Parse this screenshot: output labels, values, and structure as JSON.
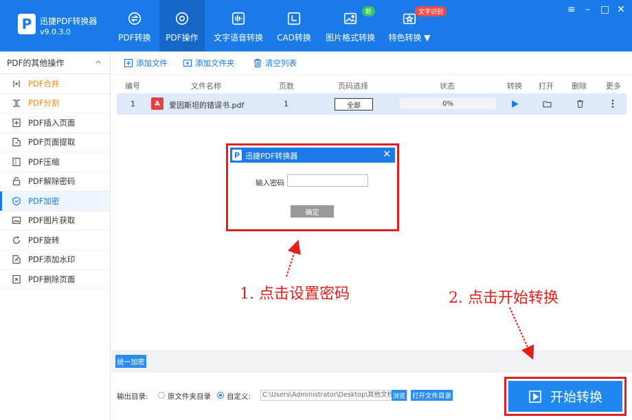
{
  "app": {
    "name": "迅捷PDF转换器",
    "version": "v9.0.3.0"
  },
  "tabs": [
    {
      "label": "PDF转换",
      "icon": "pdf-convert-icon"
    },
    {
      "label": "PDF操作",
      "icon": "gear-icon",
      "active": true
    },
    {
      "label": "文字语音转换",
      "icon": "audio-wave-icon"
    },
    {
      "label": "CAD转换",
      "icon": "cad-icon"
    },
    {
      "label": "图片格式转换",
      "icon": "image-icon"
    },
    {
      "label": "特色转换",
      "icon": "star-convert-icon"
    }
  ],
  "badges": {
    "new": "新",
    "feature": "文字识别"
  },
  "window_controls": {
    "menu": "≡",
    "minimize": "–",
    "maximize": "□",
    "close": "✕"
  },
  "sidebar": {
    "header": "PDF的其他操作",
    "items": [
      {
        "label": "PDF合并",
        "icon": "merge-icon",
        "style": "orange"
      },
      {
        "label": "PDF分割",
        "icon": "split-icon",
        "style": "orange"
      },
      {
        "label": "PDF插入页面",
        "icon": "insert-page-icon"
      },
      {
        "label": "PDF页面提取",
        "icon": "extract-page-icon"
      },
      {
        "label": "PDF压缩",
        "icon": "compress-icon"
      },
      {
        "label": "PDF解除密码",
        "icon": "unlock-icon"
      },
      {
        "label": "PDF加密",
        "icon": "shield-icon",
        "style": "blue",
        "active": true
      },
      {
        "label": "PDF图片获取",
        "icon": "picture-icon"
      },
      {
        "label": "PDF旋转",
        "icon": "rotate-icon"
      },
      {
        "label": "PDF添加水印",
        "icon": "watermark-icon"
      },
      {
        "label": "PDF删除页面",
        "icon": "delete-page-icon"
      }
    ]
  },
  "toolbar": {
    "add_file": "添加文件",
    "add_folder": "添加文件夹",
    "clear_list": "清空列表"
  },
  "table": {
    "headers": {
      "index": "编号",
      "filename": "文件名称",
      "pages": "页数",
      "page_select": "页码选择",
      "status": "状态",
      "convert": "转换",
      "open": "打开",
      "delete": "删除",
      "more": "更多"
    },
    "rows": [
      {
        "index": "1",
        "filename": "爱因斯坦的错误书.pdf",
        "pages": "1",
        "page_select": "全部",
        "status": "0%",
        "progress": 0
      }
    ]
  },
  "dialog": {
    "title": "迅捷PDF转换器",
    "password_label": "输入密码",
    "ok": "确定",
    "close": "✕"
  },
  "bottom": {
    "unify_button": "统一加密",
    "output_label": "输出目录:",
    "option_original": "原文件夹目录",
    "option_custom": "自定义:",
    "path": "C:\\Users\\Administrator\\Desktop\\其他文档",
    "browse": "浏览",
    "open_dir": "打开文件目录",
    "start": "开始转换"
  },
  "annotations": {
    "step1": "1. 点击设置密码",
    "step2": "2. 点击开始转换"
  },
  "colors": {
    "header": "#1a7be8",
    "active_tab": "#1467c7",
    "accent": "#e02020",
    "orange": "#f08a1c"
  }
}
